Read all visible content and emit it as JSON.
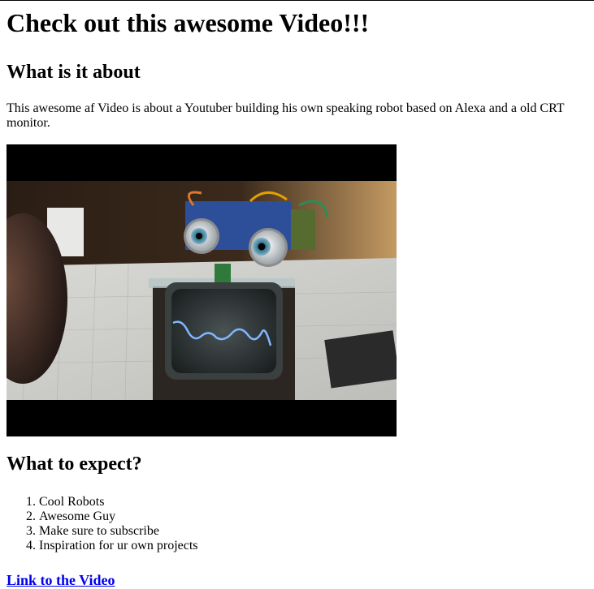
{
  "page": {
    "title": "Check out this awesome Video!!!",
    "about": {
      "heading": "What is it about",
      "text": "This awesome af Video is about a Youtuber building his own speaking robot based on Alexa and a old CRT monitor."
    },
    "expect": {
      "heading": "What to expect?",
      "items": [
        "Cool Robots",
        "Awesome Guy",
        "Make sure to subscribe",
        "Inspiration for ur own projects"
      ]
    },
    "link": {
      "label": "Link to the Video"
    }
  },
  "colors": {
    "link": "#0000ee",
    "video_letterbox": "#000000"
  }
}
